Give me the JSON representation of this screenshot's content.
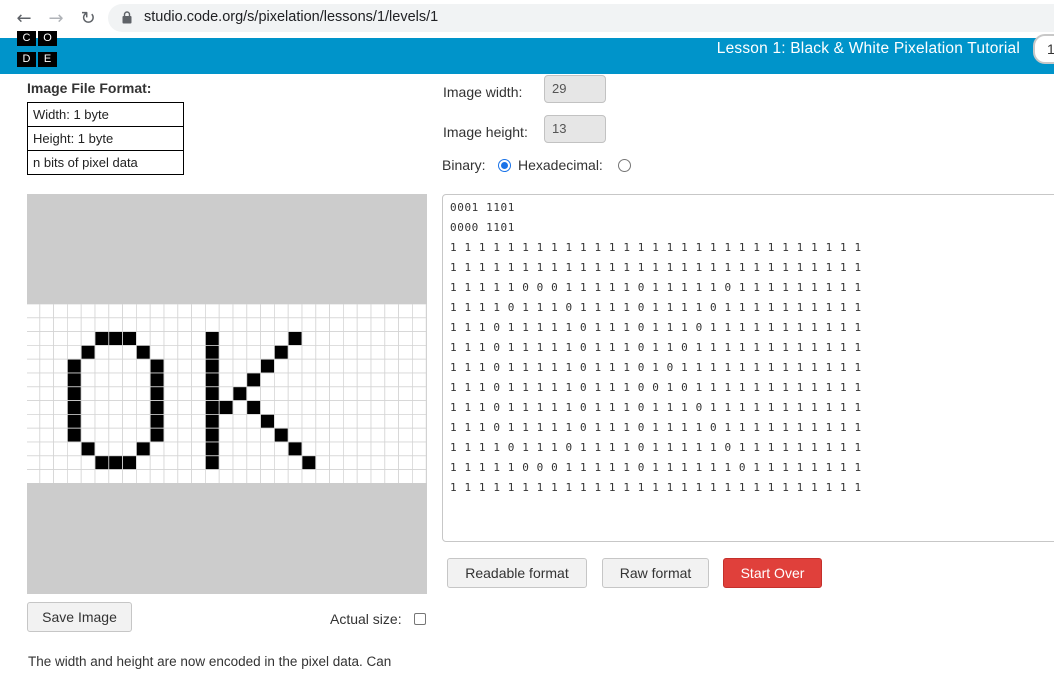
{
  "browser": {
    "url": "studio.code.org/s/pixelation/lessons/1/levels/1"
  },
  "header": {
    "logo_letters": [
      "C",
      "O",
      "D",
      "E"
    ],
    "lesson_title": "Lesson 1: Black & White Pixelation Tutorial",
    "progress_label": "1",
    "bar_color": "#0094ca"
  },
  "format_table": {
    "heading": "Image File Format:",
    "rows": [
      "Width: 1 byte",
      "Height: 1 byte",
      "n bits of pixel data"
    ]
  },
  "controls": {
    "width_label": "Image width:",
    "width_value": "29",
    "height_label": "Image height:",
    "height_value": "13",
    "binary_label": "Binary:",
    "hex_label": "Hexadecimal:",
    "mode": "binary"
  },
  "pixel_data": {
    "header_lines": [
      "0001 1101",
      "0000 1101"
    ],
    "rows": [
      "11111111111111111111111111111",
      "11111111111111111111111111111",
      "11111000111110111110111111111",
      "11110111011110111101111111111",
      "11101111101110111011111111111",
      "11101111101110110111111111111",
      "11101111101110101111111111111",
      "11101111101110010111111111111",
      "11101111101110111011111111111",
      "11101111101110111101111111111",
      "11110111011110111110111111111",
      "11111000111110111111011111111",
      "11111111111111111111111111111"
    ]
  },
  "buttons": {
    "readable": "Readable format",
    "raw": "Raw format",
    "start_over": "Start Over",
    "save_image": "Save Image",
    "start_over_color": "#e0403b"
  },
  "actual_size_label": "Actual size:",
  "instructions": "The width and height are now encoded in the pixel data. Can"
}
